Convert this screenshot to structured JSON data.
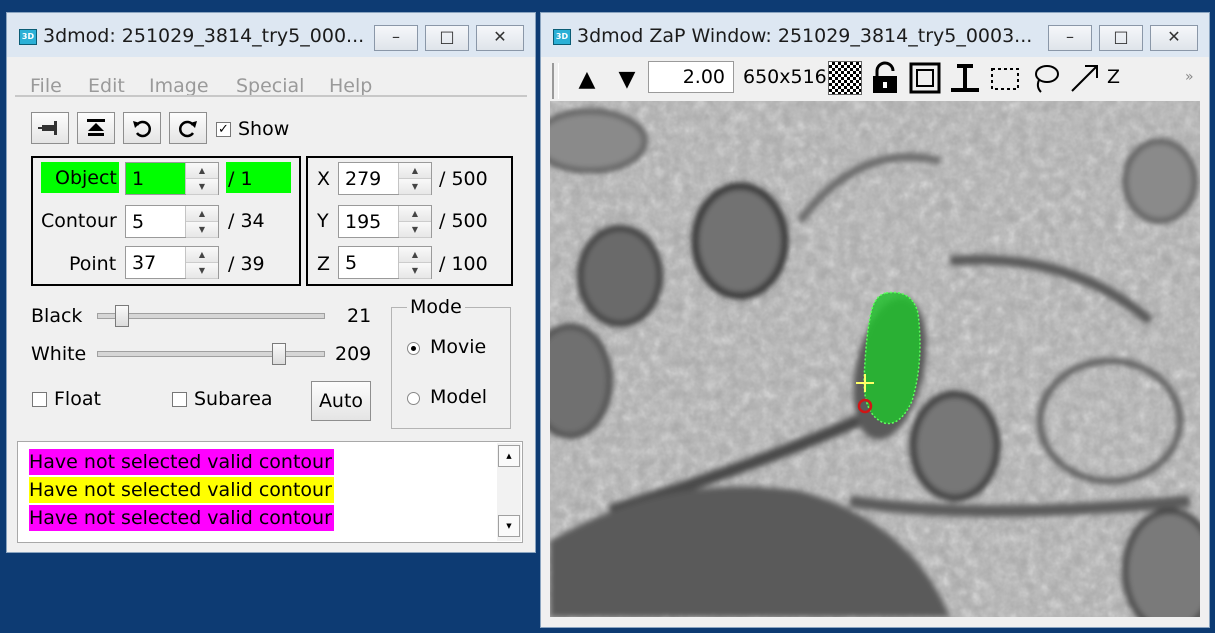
{
  "info_window": {
    "title": "3dmod: 251029_3814_try5_000...",
    "icon_label": "3D",
    "controls": {
      "minimize": "▭",
      "maximize": "▣",
      "close": "✕"
    },
    "menu": [
      "File",
      "Edit",
      "Image",
      "Special",
      "Help"
    ],
    "toolbar": {
      "show_label": "Show",
      "show_checked": true
    },
    "object": {
      "label": "Object",
      "value": "1",
      "total": "/ 1",
      "highlight": "#00ff00"
    },
    "contour": {
      "label": "Contour",
      "value": "5",
      "total": "/ 34"
    },
    "point": {
      "label": "Point",
      "value": "37",
      "total": "/ 39"
    },
    "x": {
      "label": "X",
      "value": "279",
      "total": "/ 500"
    },
    "y": {
      "label": "Y",
      "value": "195",
      "total": "/ 500"
    },
    "z": {
      "label": "Z",
      "value": "5",
      "total": "/ 100"
    },
    "black": {
      "label": "Black",
      "value": "21"
    },
    "white": {
      "label": "White",
      "value": "209"
    },
    "float_label": "Float",
    "subarea_label": "Subarea",
    "auto_label": "Auto",
    "mode": {
      "title": "Mode",
      "movie": "Movie",
      "model": "Model",
      "selected": "Movie"
    },
    "messages": [
      {
        "text": "Have not selected valid contour",
        "color": "#ff00ff"
      },
      {
        "text": "Have not selected valid contour",
        "color": "#ffff00"
      },
      {
        "text": "Have not selected valid contour",
        "color": "#ff00ff"
      }
    ]
  },
  "zap_window": {
    "title": "3dmod ZaP Window: 251029_3814_try5_0003...",
    "icon_label": "3D",
    "zoom": "2.00",
    "size": "650x516",
    "z_label": "Z",
    "more": "»",
    "contour_color": "#00cc00"
  }
}
